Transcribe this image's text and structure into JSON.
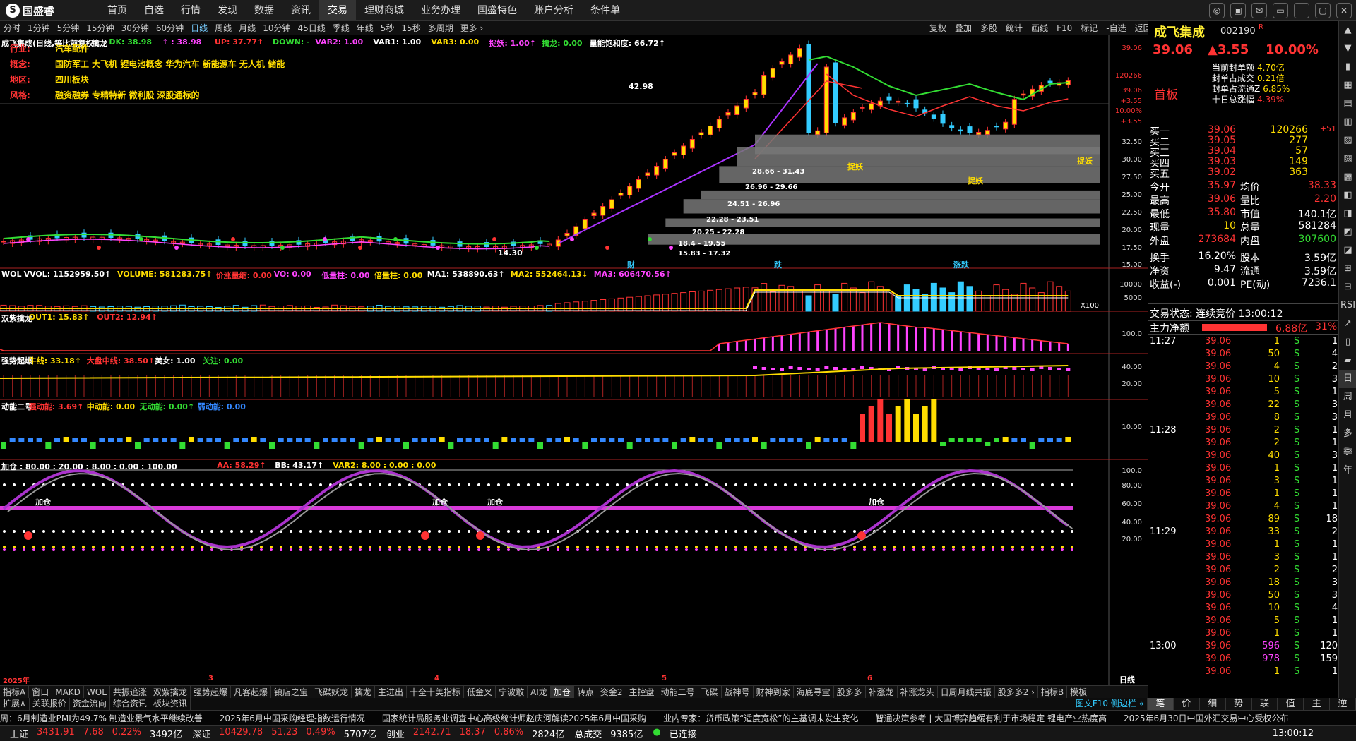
{
  "app": {
    "logo": "国盛睿",
    "logo_glyph": "S"
  },
  "topnav": [
    "首页",
    "自选",
    "行情",
    "发现",
    "数据",
    "资讯",
    "交易",
    "理财商城",
    "业务办理",
    "国盛特色",
    "账户分析",
    "条件单"
  ],
  "topnav_active": 6,
  "window_buttons": [
    "◎",
    "▣",
    "✉",
    "▭",
    "—",
    "▢",
    "✕"
  ],
  "periods": [
    "分时",
    "1分钟",
    "5分钟",
    "15分钟",
    "30分钟",
    "60分钟",
    "日线",
    "周线",
    "月线",
    "10分钟",
    "45日线",
    "季线",
    "年线",
    "5秒",
    "15秒",
    "多周期",
    "更多 ›"
  ],
  "period_active": 6,
  "right_tools": [
    "复权",
    "叠加",
    "多股",
    "统计",
    "画线",
    "F10",
    "标记",
    "-自选",
    "返回"
  ],
  "main_chart": {
    "header": [
      {
        "t": "成飞集成(日线,等比前复权)",
        "c": "#ffffff"
      },
      {
        "t": "◇",
        "c": "#ffffff"
      },
      {
        "t": "擒龙",
        "c": "#ffffff"
      },
      {
        "t": "DK: 38.98",
        "c": "#33dd33"
      },
      {
        "t": "↑ : 38.98",
        "c": "#ff44ff"
      },
      {
        "t": "UP: 37.77↑",
        "c": "#ff3333"
      },
      {
        "t": "DOWN: -",
        "c": "#33dd33"
      },
      {
        "t": "VAR2: 1.00",
        "c": "#ff44ff"
      },
      {
        "t": "VAR1: 1.00",
        "c": "#ffffff"
      },
      {
        "t": "VAR3: 0.00",
        "c": "#ffdd00"
      },
      {
        "t": "捉妖: 1.00↑",
        "c": "#ff44ff"
      },
      {
        "t": "擒龙: 0.00",
        "c": "#33dd33"
      },
      {
        "t": "量能饱和度: 66.72↑",
        "c": "#ffffff"
      }
    ],
    "info": [
      {
        "k": "行业:",
        "v": "汽车配件"
      },
      {
        "k": "概念:",
        "v": "国防军工 大飞机 锂电池概念 华为汽车 新能源车 无人机 储能"
      },
      {
        "k": "地区:",
        "v": "四川板块"
      },
      {
        "k": "风格:",
        "v": "融资融券 专精特新 微利股 深股通标的"
      }
    ],
    "yaxis": [
      "39.06",
      "120266",
      "39.06",
      "+3.55",
      "10.00%",
      "+3.55",
      "32.50",
      "30.00",
      "27.50",
      "25.00",
      "22.50",
      "20.00",
      "17.50",
      "15.00"
    ],
    "annotations": [
      "42.98",
      "捉妖",
      "捉妖",
      "14.30",
      "28.66 - 31.43",
      "26.96 - 29.66",
      "24.51 - 26.96",
      "22.28 - 23.51",
      "20.25 - 22.28",
      "18.4 - 19.55",
      "15.83 - 17.32",
      "捉妖"
    ],
    "markers": [
      "财",
      "跌",
      "涨跌"
    ]
  },
  "wol": {
    "header": [
      {
        "t": "WOL",
        "c": "#ffffff"
      },
      {
        "t": "VVOL: 1152959.50↑",
        "c": "#ffffff"
      },
      {
        "t": "VOLUME: 581283.75↑",
        "c": "#ffdd00"
      },
      {
        "t": "价涨量缩: 0.00",
        "c": "#ff3333"
      },
      {
        "t": "VO: 0.00",
        "c": "#ff44ff"
      },
      {
        "t": "低量柱: 0.00",
        "c": "#ff44ff"
      },
      {
        "t": "倍量柱: 0.00",
        "c": "#ffdd00"
      },
      {
        "t": "MA1: 538890.63↑",
        "c": "#ffffff"
      },
      {
        "t": "MA2: 552464.13↓",
        "c": "#ffdd00"
      },
      {
        "t": "MA3: 606470.56↑",
        "c": "#ff44ff"
      }
    ],
    "yaxis": [
      "10000",
      "5000"
    ],
    "unit": "X100"
  },
  "shuangzi": {
    "header": [
      {
        "t": "双紫擒龙",
        "c": "#ffffff"
      },
      {
        "t": "OUT1: 15.83↑",
        "c": "#ffdd00"
      },
      {
        "t": "OUT2: 12.94↑",
        "c": "#ff3333"
      }
    ],
    "yaxis": [
      "100.0"
    ]
  },
  "qiangshi": {
    "header": [
      {
        "t": "强势起爆",
        "c": "#ffffff"
      },
      {
        "t": "牛线: 33.18↑",
        "c": "#ffdd00"
      },
      {
        "t": "大盘中线: 38.50↑",
        "c": "#ff3333"
      },
      {
        "t": "美女: 1.00",
        "c": "#ffffff"
      },
      {
        "t": "关注: 0.00",
        "c": "#33dd33"
      }
    ],
    "yaxis": [
      "40.00",
      "20.00"
    ]
  },
  "dongneng": {
    "header": [
      {
        "t": "动能二号",
        "c": "#ffffff"
      },
      {
        "t": "强动能: 3.69↑",
        "c": "#ff3333"
      },
      {
        "t": "中动能: 0.00",
        "c": "#ffdd00"
      },
      {
        "t": "无动能: 0.00↑",
        "c": "#33dd33"
      },
      {
        "t": "弱动能: 0.00",
        "c": "#3388ff"
      }
    ],
    "yaxis": [
      "10.00"
    ]
  },
  "jiacang": {
    "header": [
      {
        "t": "加仓 : 80.00 : 20.00 : 8.00 : 0.00 : 100.00",
        "c": "#ffffff"
      },
      {
        "t": "AA: 58.29↑",
        "c": "#ff3333"
      },
      {
        "t": "BB: 43.17↑",
        "c": "#ffffff"
      },
      {
        "t": "VAR2: 8.00 : 0.00 : 0.00",
        "c": "#ffdd00"
      }
    ],
    "yaxis": [
      "100.0",
      "80.00",
      "60.00",
      "40.00",
      "20.00"
    ],
    "labels": [
      "加仓",
      "加仓",
      "加仓",
      "加仓"
    ]
  },
  "xaxis": {
    "labels": [
      "2025年",
      "3",
      "4",
      "5",
      "6"
    ],
    "period": "日线"
  },
  "bottom_tabs": [
    "指标A",
    "窗口",
    "MAKD",
    "WOL",
    "共振追涨",
    "双紫擒龙",
    "强势起爆",
    "凡客起爆",
    "镇店之宝",
    "飞碟妖龙",
    "擒龙",
    "主进出",
    "十全十美指标",
    "低金叉",
    "宁波敢",
    "AI龙",
    "加仓",
    "转点",
    "资金2",
    "主控盘",
    "动能二号",
    "飞碟",
    "战神号",
    "财神到家",
    "海底寻宝",
    "股多多",
    "补涨龙",
    "补涨龙头",
    "日周月线共振",
    "股多多2 ›",
    "指标B",
    "模板"
  ],
  "bottom_tab_active": 16,
  "sub_tabs": [
    "扩展∧",
    "关联报价",
    "资金流向",
    "综合资讯",
    "板块资讯"
  ],
  "sub_tab_active": 3,
  "sub_right": "图文F10 侧边栏 «",
  "news": [
    "周：6月制造业PMI为49.7% 制造业景气水平继续改善",
    "2025年6月中国采购经理指数运行情况",
    "国家统计局服务业调查中心高级统计师赵庆河解读2025年6月中国采购",
    "业内专家：货币政策“适度宽松”的主基调未发生变化",
    "智通决策参考 | 大国博弈趋缓有利于市场稳定 锂电产业热度高",
    "2025年6月30日中国外汇交易中心受权公布"
  ],
  "status": {
    "items": [
      {
        "n": "上证",
        "v": "3431.91",
        "c": "7.68",
        "p": "0.22%",
        "a": "3492亿"
      },
      {
        "n": "深证",
        "v": "10429.78",
        "c": "51.23",
        "p": "0.49%",
        "a": "5707亿"
      },
      {
        "n": "创业",
        "v": "2142.71",
        "c": "18.37",
        "p": "0.86%",
        "a": "2824亿"
      }
    ],
    "total_label": "总成交",
    "total": "9385亿",
    "conn": "已连接",
    "time": "13:00:12"
  },
  "stock": {
    "name": "成飞集成",
    "code": "002190",
    "flag": "R",
    "price": "39.06",
    "change": "▲3.55",
    "pct": "10.00%",
    "board": "首板",
    "seal": [
      {
        "k": "当前封单额",
        "v": "4.70亿"
      },
      {
        "k": "封单占成交",
        "v": "0.21倍"
      },
      {
        "k": "封单占流通Z",
        "v": "6.85%"
      },
      {
        "k": "十日总涨幅",
        "v": "4.39%"
      }
    ],
    "bids": [
      {
        "k": "买一",
        "p": "39.06",
        "v": "120266",
        "d": "+51"
      },
      {
        "k": "买二",
        "p": "39.05",
        "v": "277",
        "d": ""
      },
      {
        "k": "买三",
        "p": "39.04",
        "v": "57",
        "d": ""
      },
      {
        "k": "买四",
        "p": "39.03",
        "v": "149",
        "d": ""
      },
      {
        "k": "买五",
        "p": "39.02",
        "v": "363",
        "d": ""
      }
    ],
    "stats": [
      {
        "k1": "今开",
        "v1": "35.97",
        "k2": "均价",
        "v2": "38.33",
        "c1": "#ff3333",
        "c2": "#ff3333"
      },
      {
        "k1": "最高",
        "v1": "39.06",
        "k2": "量比",
        "v2": "2.20",
        "c1": "#ff3333",
        "c2": "#ff3333"
      },
      {
        "k1": "最低",
        "v1": "35.80",
        "k2": "市值",
        "v2": "140.1亿",
        "c1": "#ff3333",
        "c2": "#ffffff"
      },
      {
        "k1": "现量",
        "v1": "10",
        "k2": "总量",
        "v2": "581284",
        "c1": "#ffdd00",
        "c2": "#ffffff"
      },
      {
        "k1": "外盘",
        "v1": "273684",
        "k2": "内盘",
        "v2": "307600",
        "c1": "#ff3333",
        "c2": "#33dd33"
      },
      {
        "k1": "换手",
        "v1": "16.20%",
        "k2": "股本",
        "v2": "3.59亿",
        "c1": "#ffffff",
        "c2": "#ffffff"
      },
      {
        "k1": "净资",
        "v1": "9.47",
        "k2": "流通",
        "v2": "3.59亿",
        "c1": "#ffffff",
        "c2": "#ffffff"
      },
      {
        "k1": "收益(-)",
        "v1": "0.001",
        "k2": "PE(动)",
        "v2": "7236.1",
        "c1": "#ffffff",
        "c2": "#ffffff"
      }
    ],
    "trade_state": "交易状态: 连续竞价 13:00:12",
    "flow_label": "主力净额",
    "flow_value": "6.88亿",
    "flow_pct": "31%",
    "ticks": [
      {
        "t": "11:27",
        "p": "39.06",
        "v": "1",
        "s": "S",
        "n": "1"
      },
      {
        "t": "",
        "p": "39.06",
        "v": "50",
        "s": "S",
        "n": "4"
      },
      {
        "t": "",
        "p": "39.06",
        "v": "4",
        "s": "S",
        "n": "2"
      },
      {
        "t": "",
        "p": "39.06",
        "v": "10",
        "s": "S",
        "n": "3"
      },
      {
        "t": "",
        "p": "39.06",
        "v": "5",
        "s": "S",
        "n": "1"
      },
      {
        "t": "",
        "p": "39.06",
        "v": "22",
        "s": "S",
        "n": "3"
      },
      {
        "t": "",
        "p": "39.06",
        "v": "8",
        "s": "S",
        "n": "3"
      },
      {
        "t": "11:28",
        "p": "39.06",
        "v": "2",
        "s": "S",
        "n": "1"
      },
      {
        "t": "",
        "p": "39.06",
        "v": "2",
        "s": "S",
        "n": "1"
      },
      {
        "t": "",
        "p": "39.06",
        "v": "40",
        "s": "S",
        "n": "3"
      },
      {
        "t": "",
        "p": "39.06",
        "v": "1",
        "s": "S",
        "n": "1"
      },
      {
        "t": "",
        "p": "39.06",
        "v": "3",
        "s": "S",
        "n": "1"
      },
      {
        "t": "",
        "p": "39.06",
        "v": "1",
        "s": "S",
        "n": "1"
      },
      {
        "t": "",
        "p": "39.06",
        "v": "4",
        "s": "S",
        "n": "1"
      },
      {
        "t": "",
        "p": "39.06",
        "v": "89",
        "s": "S",
        "n": "18"
      },
      {
        "t": "11:29",
        "p": "39.06",
        "v": "33",
        "s": "S",
        "n": "2"
      },
      {
        "t": "",
        "p": "39.06",
        "v": "1",
        "s": "S",
        "n": "1"
      },
      {
        "t": "",
        "p": "39.06",
        "v": "3",
        "s": "S",
        "n": "1"
      },
      {
        "t": "",
        "p": "39.06",
        "v": "2",
        "s": "S",
        "n": "2"
      },
      {
        "t": "",
        "p": "39.06",
        "v": "18",
        "s": "S",
        "n": "3"
      },
      {
        "t": "",
        "p": "39.06",
        "v": "50",
        "s": "S",
        "n": "3"
      },
      {
        "t": "",
        "p": "39.06",
        "v": "10",
        "s": "S",
        "n": "4"
      },
      {
        "t": "",
        "p": "39.06",
        "v": "5",
        "s": "S",
        "n": "1"
      },
      {
        "t": "",
        "p": "39.06",
        "v": "1",
        "s": "S",
        "n": "1"
      },
      {
        "t": "13:00",
        "p": "39.06",
        "v": "596",
        "s": "S",
        "n": "120"
      },
      {
        "t": "",
        "p": "39.06",
        "v": "978",
        "s": "S",
        "n": "159"
      },
      {
        "t": "",
        "p": "39.06",
        "v": "1",
        "s": "S",
        "n": "1"
      }
    ]
  },
  "panel_tabs": [
    "笔",
    "价",
    "细",
    "势",
    "联",
    "值",
    "主",
    "逆"
  ],
  "panel_tab_active": 0,
  "sidebar": [
    "▲",
    "▼",
    "▮",
    "▦",
    "▤",
    "▥",
    "▧",
    "▨",
    "▩",
    "◧",
    "◨",
    "◩",
    "◪",
    "⊞",
    "⊟",
    "RSI",
    "↗",
    "▯",
    "▰",
    "日",
    "周",
    "月",
    "多",
    "季",
    "年"
  ],
  "sidebar_active": 19,
  "colors": {
    "up": "#ff3333",
    "down": "#33dd33",
    "accent": "#ffdd00",
    "cyan": "#33ccff",
    "magenta": "#ff44ff"
  },
  "chart_data": {
    "type": "candlestick",
    "title": "成飞集成(日线,等比前复权)",
    "y_range": [
      13.5,
      44
    ],
    "x_labels": [
      "2025年",
      "3",
      "4",
      "5",
      "6"
    ],
    "last_close": 39.06,
    "peak": 42.98,
    "low_mark": 14.3,
    "price_zones": [
      [
        28.66,
        31.43
      ],
      [
        26.96,
        29.66
      ],
      [
        24.51,
        26.96
      ],
      [
        22.28,
        23.51
      ],
      [
        20.25,
        22.28
      ],
      [
        18.4,
        19.55
      ],
      [
        15.83,
        17.32
      ]
    ]
  }
}
